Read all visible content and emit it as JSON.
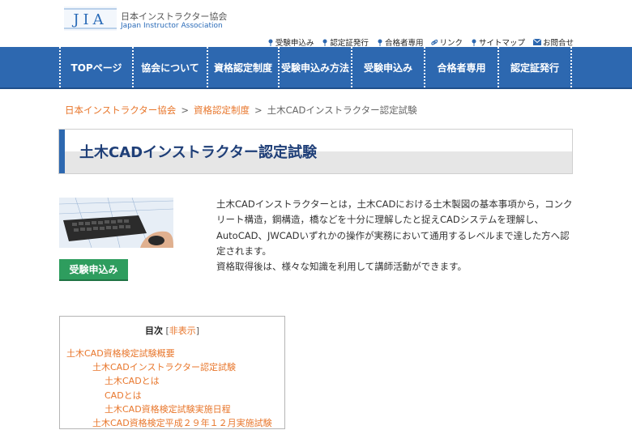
{
  "header": {
    "org_name_jp": "日本インストラクター協会",
    "org_name_en": "Japan Instructor Association",
    "logo_text": "JIA"
  },
  "utility_links": [
    {
      "label": "受験申込み",
      "icon": "pin-icon"
    },
    {
      "label": "認定証発行",
      "icon": "pin-icon"
    },
    {
      "label": "合格者専用",
      "icon": "pin-icon"
    },
    {
      "label": "リンク",
      "icon": "link-icon"
    },
    {
      "label": "サイトマップ",
      "icon": "pin-icon"
    },
    {
      "label": "お問合せ",
      "icon": "mail-icon"
    }
  ],
  "nav": {
    "items": [
      {
        "label": "TOPページ"
      },
      {
        "label": "協会について"
      },
      {
        "label": "資格認定制度"
      },
      {
        "label": "受験申込み方法"
      },
      {
        "label": "受験申込み"
      },
      {
        "label": "合格者専用"
      },
      {
        "label": "認定証発行"
      }
    ]
  },
  "breadcrumb": {
    "home": "日本インストラクター協会",
    "parent": "資格認定制度",
    "current": "土木CADインストラクター認定試験",
    "separator": ">"
  },
  "page": {
    "title": "土木CADインストラクター認定試験",
    "apply_button": "受験申込み",
    "description": "土木CADインストラクターとは，土木CADにおける土木製図の基本事項から，コンクリート構造，鋼構造，橋などを十分に理解したと捉えCADシステムを理解し、AutoCAD、JWCADいずれかの操作が実務において通用するレベルまで達した方へ認定されます。",
    "description2": "資格取得後は、様々な知識を利用して講師活動ができます。"
  },
  "toc": {
    "title": "目次",
    "toggle_open": "[",
    "toggle_label": "非表示",
    "toggle_close": "]",
    "items": [
      {
        "label": "土木CAD資格検定試験概要",
        "level": 1
      },
      {
        "label": "土木CADインストラクター認定試験",
        "level": 2
      },
      {
        "label": "土木CADとは",
        "level": 3
      },
      {
        "label": "CADとは",
        "level": 3
      },
      {
        "label": "土木CAD資格検定試験実施日程",
        "level": 3
      },
      {
        "label": "土木CAD資格検定平成２９年１２月実施試験",
        "level": 2
      }
    ]
  },
  "colors": {
    "nav_bg": "#2d68b0",
    "accent_orange": "#e8762b",
    "title_text": "#1f3f78",
    "apply_green": "#2e9d5e"
  }
}
